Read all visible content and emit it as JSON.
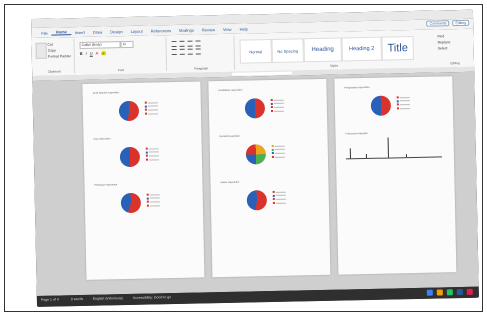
{
  "ribbon_tabs": [
    "File",
    "Home",
    "Insert",
    "Draw",
    "Design",
    "Layout",
    "References",
    "Mailings",
    "Review",
    "View",
    "Help"
  ],
  "active_tab": "Home",
  "comments_label": "Comments",
  "editing_label": "Editing",
  "clipboard": {
    "cut": "Cut",
    "copy": "Copy",
    "format_painter": "Format Painter",
    "label": "Clipboard"
  },
  "font": {
    "name": "Calibri (Body)",
    "size": "11",
    "label": "Font"
  },
  "paragraph_label": "Paragraph",
  "styles": [
    {
      "label": "Normal",
      "size": "4px"
    },
    {
      "label": "No Spacing",
      "size": "4px"
    },
    {
      "label": "Heading",
      "size": "6px"
    },
    {
      "label": "Heading 2",
      "size": "5.5px"
    },
    {
      "label": "Title",
      "size": "11px"
    }
  ],
  "styles_label": "Styles",
  "editing": {
    "find": "Find",
    "replace": "Replace",
    "select": "Select",
    "label": "Editing"
  },
  "status": {
    "page": "Page 1 of 4",
    "words": "0 words",
    "language": "English (Indonesia)",
    "accessibility": "Accessibility: Good to go"
  },
  "colors": {
    "red": "#d9332b",
    "blue": "#2a61b8",
    "green": "#4caf50",
    "orange": "#f0a31c",
    "accent": "#2b579a"
  },
  "pages": [
    {
      "charts": [
        {
          "title": "Jenis kelamin responden",
          "type": "pie",
          "slices": [
            {
              "label": "Laki-laki",
              "color": "#d9332b",
              "pct": 52
            },
            {
              "label": "Perempuan",
              "color": "#2a61b8",
              "pct": 48
            }
          ],
          "legend_count": 4
        },
        {
          "title": "Usia responden",
          "type": "pie",
          "slices": [
            {
              "label": "A",
              "color": "#d9332b",
              "pct": 50
            },
            {
              "label": "B",
              "color": "#2a61b8",
              "pct": 50
            }
          ],
          "legend_count": 4
        },
        {
          "title": "Pekerjaan responden",
          "type": "pie",
          "slices": [
            {
              "label": "A",
              "color": "#d9332b",
              "pct": 55
            },
            {
              "label": "B",
              "color": "#2a61b8",
              "pct": 45
            }
          ],
          "legend_count": 4
        }
      ]
    },
    {
      "charts": [
        {
          "title": "Pendidikan responden",
          "type": "pie",
          "slices": [
            {
              "label": "A",
              "color": "#d9332b",
              "pct": 50
            },
            {
              "label": "B",
              "color": "#2a61b8",
              "pct": 50
            }
          ],
          "legend_count": 4
        },
        {
          "title": "Domisili responden",
          "type": "pie",
          "slices": [
            {
              "label": "A",
              "color": "#f0a31c",
              "pct": 25
            },
            {
              "label": "B",
              "color": "#4caf50",
              "pct": 25
            },
            {
              "label": "C",
              "color": "#2a61b8",
              "pct": 25
            },
            {
              "label": "D",
              "color": "#d9332b",
              "pct": 25
            }
          ],
          "legend_count": 4
        },
        {
          "title": "Status responden",
          "type": "pie",
          "slices": [
            {
              "label": "A",
              "color": "#d9332b",
              "pct": 52
            },
            {
              "label": "B",
              "color": "#2a61b8",
              "pct": 48
            }
          ],
          "legend_count": 4
        }
      ]
    },
    {
      "charts": [
        {
          "title": "Penghasilan responden",
          "type": "pie",
          "slices": [
            {
              "label": "A",
              "color": "#d9332b",
              "pct": 50
            },
            {
              "label": "B",
              "color": "#2a61b8",
              "pct": 50
            }
          ],
          "legend_count": 4
        },
        {
          "title": "Frekuensi kunjungan",
          "type": "line"
        }
      ]
    }
  ]
}
